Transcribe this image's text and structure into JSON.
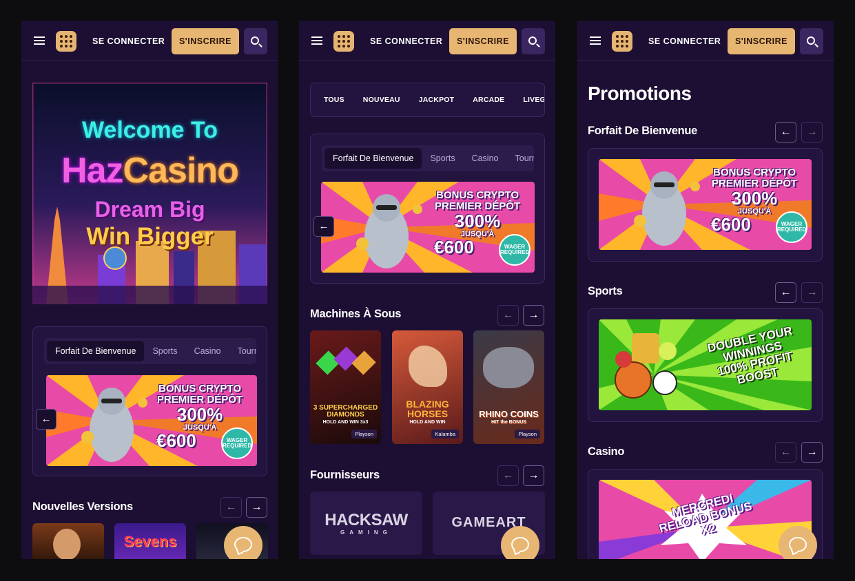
{
  "header": {
    "login_label": "SE CONNECTER",
    "signup_label": "S'INSCRIRE"
  },
  "screen1": {
    "hero": {
      "line1": "Welcome To",
      "line2a": "Haz",
      "line2b": "Casino",
      "line3": "Dream Big",
      "line4": "Win Bigger"
    },
    "promo_tabs": [
      "Forfait De Bienvenue",
      "Sports",
      "Casino",
      "Tourn"
    ],
    "new_releases_title": "Nouvelles Versions",
    "new_release_games": [
      "Sevens"
    ]
  },
  "screen2": {
    "filters": [
      "TOUS",
      "NOUVEAU",
      "JACKPOT",
      "ARCADE",
      "LIVEGAMES"
    ],
    "promo_tabs": [
      "Forfait De Bienvenue",
      "Sports",
      "Casino",
      "Tourn"
    ],
    "slots_title": "Machines À Sous",
    "slots": [
      {
        "name": "3 SUPERCHARGED DIAMONDS",
        "sub": "HOLD AND WIN 3x3",
        "provider": "Playson"
      },
      {
        "name": "BLAZING HORSES",
        "sub": "HOLD AND WIN",
        "provider": "Kalamba"
      },
      {
        "name": "RHINO COINS",
        "sub": "HIT the BONUS",
        "provider": "Playson"
      }
    ],
    "providers_title": "Fournisseurs",
    "providers": [
      "HACKSAW",
      "GAMING",
      "GAMEART"
    ]
  },
  "screen3": {
    "page_title": "Promotions",
    "sections": [
      {
        "title": "Forfait De Bienvenue"
      },
      {
        "title": "Sports",
        "banner_text": [
          "DOUBLE YOUR",
          "WINNINGS",
          "100% PROFIT",
          "BOOST"
        ]
      },
      {
        "title": "Casino",
        "banner_text": [
          "MERCREDI",
          "RELOAD BONUS",
          "X2"
        ]
      }
    ]
  },
  "welcome_banner": {
    "line1": "BONUS CRYPTO",
    "line2": "PREMIER DÉPÔT",
    "line3": "300%",
    "line4": "JUSQU'À",
    "line5": "€600",
    "badge1": "WAGER",
    "badge2": "REQUIRED"
  },
  "colors": {
    "background": "#1c0f33",
    "accent": "#e8b673",
    "card": "#22143f"
  }
}
